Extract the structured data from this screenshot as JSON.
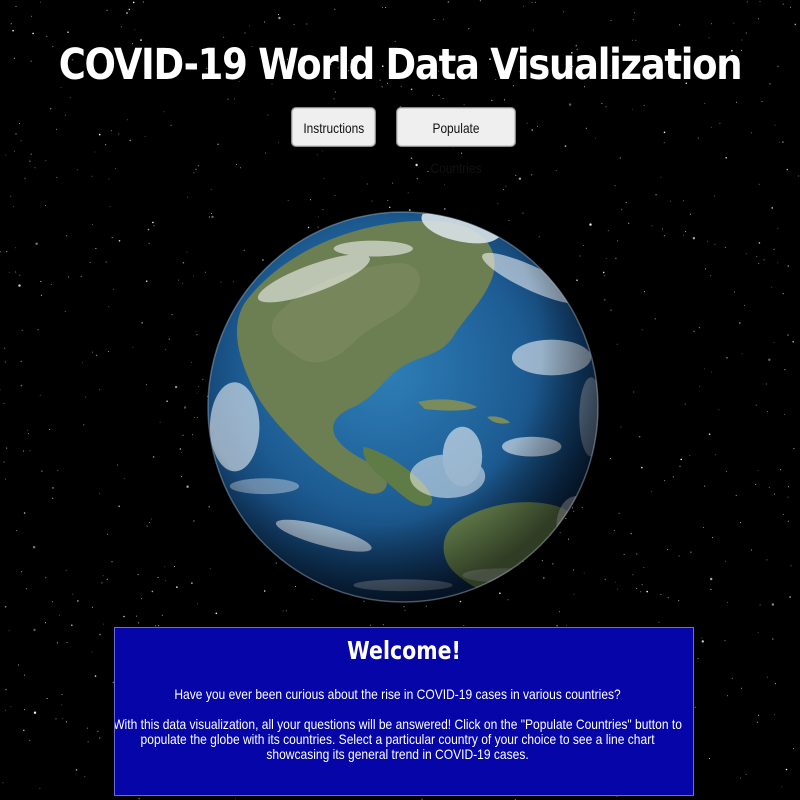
{
  "page": {
    "title": "COVID-19 World Data Visualization"
  },
  "toolbar": {
    "instructions_label": "Instructions",
    "populate_label": "Populate Countries"
  },
  "globe": {
    "description_icon": "earth-globe"
  },
  "welcome": {
    "heading": "Welcome!",
    "intro": "Have you ever been curious about the rise in COVID-19 cases in various countries?",
    "body": "With this data visualization, all your questions will be answered! Click on the \"Populate Countries\" button to populate the globe with its countries. Select a particular country of your choice to see a line chart showcasing its general trend in COVID-19 cases."
  },
  "colors": {
    "background": "#000000",
    "panel": "#0505a8",
    "button": "#efefef",
    "ocean": "#1f5f95",
    "land": "#5d7a4a"
  }
}
